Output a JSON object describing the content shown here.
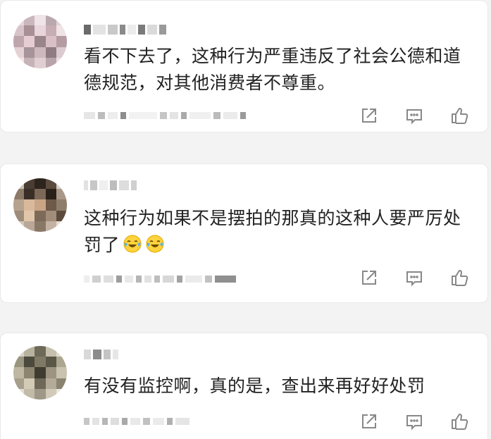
{
  "comments": [
    {
      "text": "看不下去了，这种行为严重违反了社会公德和道德规范，对其他消费者不尊重。",
      "emoji_count": 0
    },
    {
      "text": "这种行为如果不是摆拍的那真的这种人要严厉处罚了",
      "emoji_count": 2,
      "emoji_icon": "laughing-crying-emoji-icon"
    },
    {
      "text": "有没有监控啊，真的是，查出来再好好处罚",
      "emoji_count": 0
    }
  ],
  "actions": {
    "share_icon": "share-icon",
    "reply_icon": "comment-reply-icon",
    "like_icon": "thumbs-up-icon",
    "icon_color": "#888888"
  },
  "colors": {
    "background": "#f3f3f3",
    "card": "#ffffff",
    "text": "#222222",
    "blur": "#d5d5d5"
  }
}
